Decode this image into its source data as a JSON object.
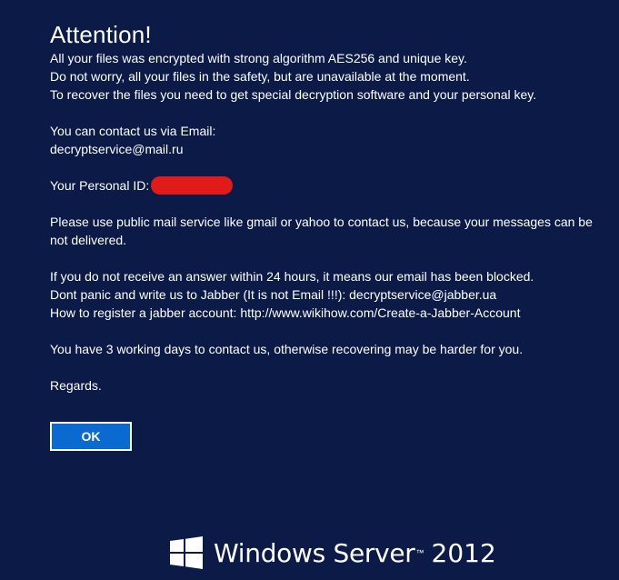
{
  "title": "Attention!",
  "paragraphs": {
    "p1_l1": "All your files was encrypted with strong algorithm AES256 and unique key.",
    "p1_l2": "Do not worry, all your files in the safety, but are unavailable at the moment.",
    "p1_l3": "To recover the files you need to get special decryption software and your personal key.",
    "p2_l1": "You can contact us via Email:",
    "p2_l2": "decryptservice@mail.ru",
    "personal_id_label": "Your Personal ID:",
    "p3": "Please use public mail service like gmail or yahoo to contact us, because your messages can be not delivered.",
    "p4_l1": "If you do not receive an answer within 24 hours, it means our email has been blocked.",
    "p4_l2": "Dont panic and write us to Jabber (It is not Email !!!): decryptservice@jabber.ua",
    "p4_l3": "How to register a jabber account: http://www.wikihow.com/Create-a-Jabber-Account",
    "p5": "You have 3 working days to contact us, otherwise recovering may be harder for you.",
    "p6": "Regards."
  },
  "ok_button": {
    "label": "OK"
  },
  "brand": {
    "name": "Windows Server",
    "version": "2012",
    "icon": "windows-logo-icon"
  },
  "colors": {
    "background": "#0b1a46",
    "button": "#0a6ad0",
    "redaction": "#e11a1a"
  }
}
